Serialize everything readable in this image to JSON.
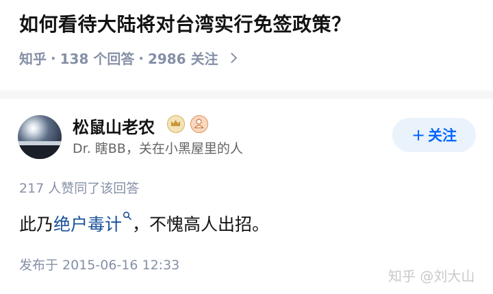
{
  "question": {
    "title": "如何看待大陆将对台湾实行免签政策？",
    "platform": "知乎",
    "answer_count": "138 个回答",
    "follower_count": "2986 关注"
  },
  "author": {
    "name": "松鼠山老农",
    "description": "Dr. 瞎BB，关在小黑屋里的人",
    "follow_label": "关注",
    "follow_plus": "+"
  },
  "answer": {
    "votes": "217 人赞同了该回答",
    "text_before": "此乃",
    "link_text": "绝户毒计",
    "text_after": "，不愧高人出招。",
    "publish_time": "发布于 2015-06-16 12:33"
  },
  "watermark": "知乎 @刘大山",
  "colors": {
    "accent": "#0066ff",
    "link": "#175199",
    "meta": "#8590a6",
    "follow_bg": "#eaf2fc"
  },
  "icons": [
    "chevron-right-icon",
    "crown-badge-icon",
    "user-badge-icon",
    "search-icon"
  ]
}
